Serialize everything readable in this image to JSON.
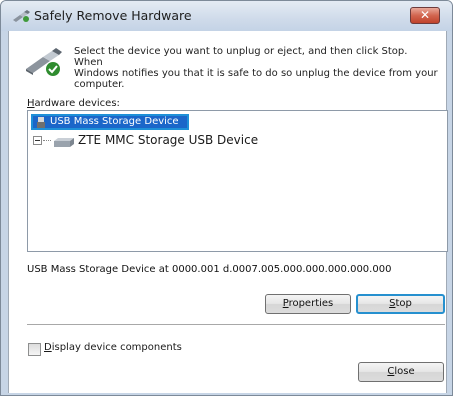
{
  "window": {
    "title": "Safely Remove Hardware",
    "close_glyph": "✕"
  },
  "instructions": {
    "line1": "Select the device you want to unplug or eject, and then click Stop. When",
    "line2": "Windows notifies you that it is safe to do so unplug the device from your",
    "line3": "computer."
  },
  "hardware_label": {
    "mnemonic": "H",
    "rest": "ardware devices:"
  },
  "devices": [
    {
      "label": "USB Mass Storage Device",
      "selected": true,
      "icon": "usb-icon"
    },
    {
      "label": "ZTE MMC Storage USB Device",
      "selected": false,
      "icon": "drive-icon"
    }
  ],
  "device_info": "USB Mass Storage Device at 0000.001 d.0007.005.000.000.000.000.000",
  "buttons": {
    "properties": {
      "mnemonic": "P",
      "rest": "roperties"
    },
    "stop": {
      "mnemonic": "S",
      "rest": "top"
    },
    "close": {
      "mnemonic": "C",
      "rest": "lose"
    }
  },
  "options": {
    "display_components": {
      "mnemonic": "D",
      "rest": "isplay device components",
      "checked": false
    }
  },
  "colors": {
    "selection": "#1b66c9",
    "focus_border": "#2690cf",
    "frame": "#c7d5e6"
  }
}
